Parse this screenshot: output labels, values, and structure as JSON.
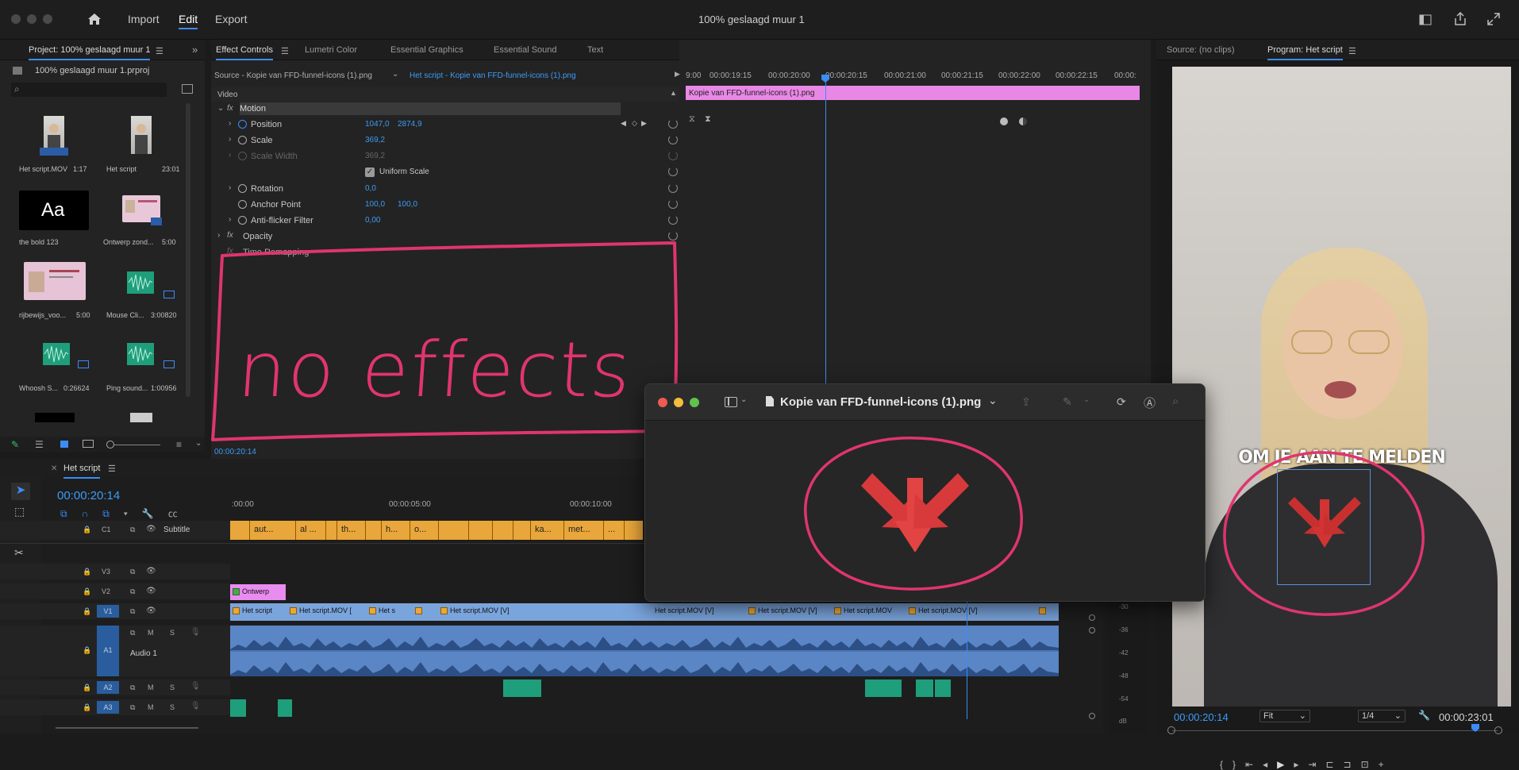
{
  "window": {
    "title": "100% geslaagd muur 1"
  },
  "menu": {
    "import": "Import",
    "edit": "Edit",
    "export": "Export"
  },
  "project": {
    "tab": "Project: 100% geslaagd muur 1",
    "file": "100% geslaagd muur 1.prproj",
    "items": [
      {
        "name": "Het script.MOV",
        "dur": "1:17"
      },
      {
        "name": "Het script",
        "dur": "23:01"
      },
      {
        "name": "the bold 123",
        "dur": ""
      },
      {
        "name": "Ontwerp zond...",
        "dur": "5:00"
      },
      {
        "name": "rijbewijs_voo...",
        "dur": "5:00"
      },
      {
        "name": "Mouse Cli...",
        "dur": "3:00820"
      },
      {
        "name": "Whoosh S...",
        "dur": "0:26624"
      },
      {
        "name": "Ping sound...",
        "dur": "1:00956"
      }
    ],
    "font_thumb": "Aa"
  },
  "effect_controls": {
    "tabs": [
      "Effect Controls",
      "Lumetri Color",
      "Essential Graphics",
      "Essential Sound",
      "Text"
    ],
    "source": "Source - Kopie van FFD-funnel-icons (1).png",
    "sequence_clip": "Het script - Kopie van FFD-funnel-icons (1).png",
    "video_label": "Video",
    "motion": "Motion",
    "position": {
      "label": "Position",
      "x": "1047,0",
      "y": "2874,9"
    },
    "scale": {
      "label": "Scale",
      "v": "369,2"
    },
    "scale_width": {
      "label": "Scale Width",
      "v": "369,2"
    },
    "uniform_scale": "Uniform Scale",
    "rotation": {
      "label": "Rotation",
      "v": "0,0"
    },
    "anchor": {
      "label": "Anchor Point",
      "x": "100,0",
      "y": "100,0"
    },
    "antiflicker": {
      "label": "Anti-flicker Filter",
      "v": "0,00"
    },
    "opacity": "Opacity",
    "time_remapping": "Time Remapping",
    "timecode": "00:00:20:14",
    "ruler": [
      "9:00",
      "00:00:19:15",
      "00:00:20:00",
      "00:00:20:15",
      "00:00:21:00",
      "00:00:21:15",
      "00:00:22:00",
      "00:00:22:15",
      "00:00:"
    ],
    "clip_bar": "Kopie van FFD-funnel-icons (1).png",
    "annotation": "no effects"
  },
  "program": {
    "source_tab": "Source: (no clips)",
    "program_tab": "Program: Het script",
    "caption": "OM JE AAN TE MELDEN",
    "timecode": "00:00:20:14",
    "fit": "Fit",
    "quality": "1/4",
    "duration": "00:00:23:01"
  },
  "timeline": {
    "tab": "Het script",
    "timecode": "00:00:20:14",
    "ruler": [
      ":00:00",
      "00:00:05:00",
      "00:00:10:00"
    ],
    "subtitle_track": {
      "id": "C1",
      "name": "Subtitle"
    },
    "subtitle_clips": [
      "aut...",
      "al ...",
      "th...",
      "h...",
      "o...",
      "ka...",
      "met...",
      "..."
    ],
    "tracks": [
      "V3",
      "V2",
      "V1",
      "A1",
      "A2",
      "A3"
    ],
    "audio1_name": "Audio 1",
    "v2_clip": "Ontwerp",
    "v1_clips": [
      "Het script",
      "Het script.MOV [",
      "Het s",
      "",
      "Het script.MOV [V]",
      "Het script.MOV [V]",
      "Het script.MOV [V]",
      "Het script.MOV",
      "Het script.MOV [V]"
    ],
    "meter": [
      "-30",
      "-36",
      "-42",
      "-48",
      "-54",
      "dB"
    ]
  },
  "preview": {
    "filename": "Kopie van FFD-funnel-icons (1).png"
  },
  "colors": {
    "accent": "#3b8cf7",
    "annotation": "#e0356f",
    "subtitle_clip": "#e9a63a",
    "video_clip": "#7aa4dc",
    "graphic_clip": "#e98cef"
  }
}
